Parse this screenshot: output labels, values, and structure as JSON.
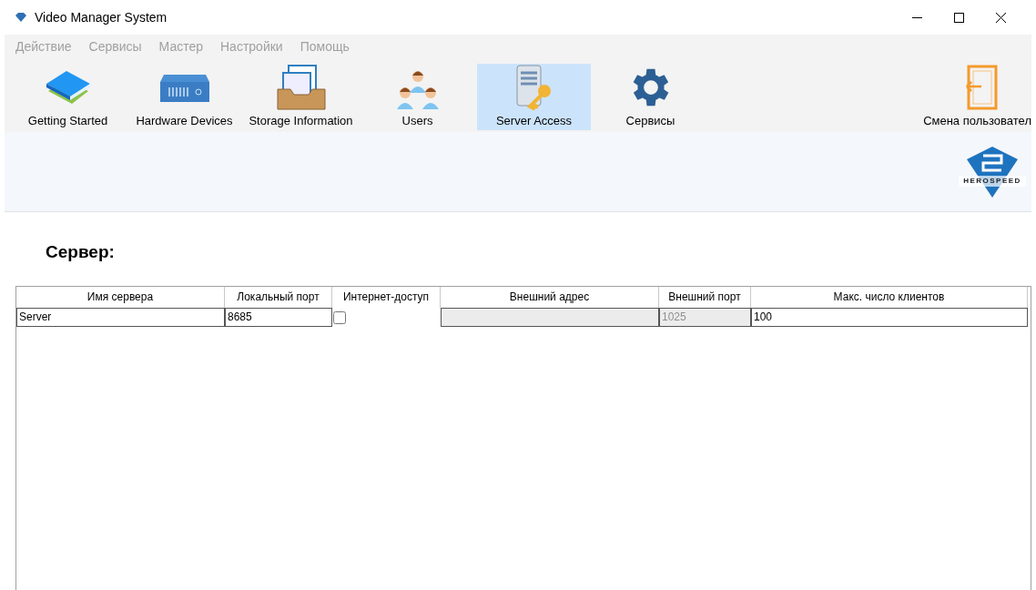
{
  "window": {
    "title": "Video Manager System"
  },
  "menu": [
    {
      "label": "Действие",
      "disabled": true
    },
    {
      "label": "Сервисы",
      "disabled": true
    },
    {
      "label": "Мастер",
      "disabled": true
    },
    {
      "label": "Настройки",
      "disabled": true
    },
    {
      "label": "Помощь",
      "disabled": true
    }
  ],
  "toolbar": [
    {
      "kind": "books",
      "label": "Getting Started",
      "selected": false
    },
    {
      "kind": "device",
      "label": "Hardware Devices",
      "selected": false
    },
    {
      "kind": "tray",
      "label": "Storage Information",
      "selected": false
    },
    {
      "kind": "users",
      "label": "Users",
      "selected": false
    },
    {
      "kind": "server",
      "label": "Server Access",
      "selected": true
    },
    {
      "kind": "gear",
      "label": "Сервисы",
      "selected": false
    }
  ],
  "switch_user": {
    "label": "Смена пользовател"
  },
  "logo": {
    "text": "HEROSPEED"
  },
  "section_title": "Сервер:",
  "table": {
    "columns": [
      "Имя сервера",
      "Локальный порт",
      "Интернет-доступ",
      "Внешний адрес",
      "Внешний порт",
      "Макс. число клиентов"
    ],
    "rows": [
      [
        {
          "kind": "text",
          "value": "Server",
          "disabled": false
        },
        {
          "kind": "text",
          "value": "8685",
          "disabled": false
        },
        {
          "kind": "checkbox",
          "checked": false
        },
        {
          "kind": "text",
          "disabled": true
        },
        {
          "kind": "text",
          "value": "1025",
          "disabled": true
        },
        {
          "kind": "text",
          "value": "100",
          "disabled": false
        }
      ]
    ]
  }
}
